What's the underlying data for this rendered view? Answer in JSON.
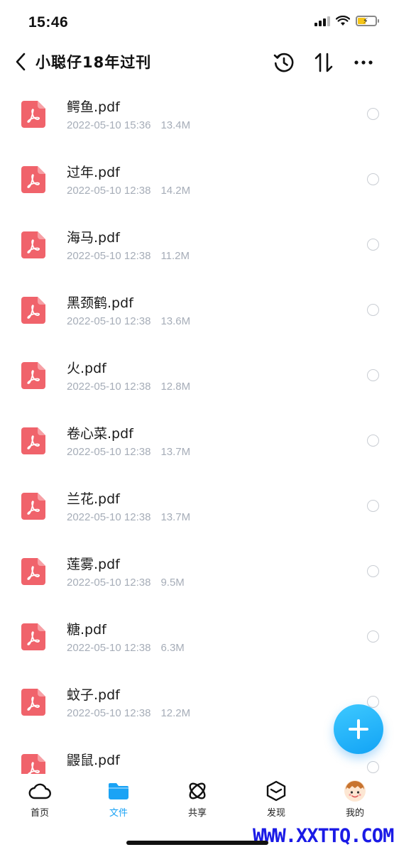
{
  "status_bar": {
    "time": "15:46"
  },
  "header": {
    "title": "小聪仔18年过刊"
  },
  "files": [
    {
      "name": "鳄鱼.pdf",
      "date": "2022-05-10 15:36",
      "size": "13.4M"
    },
    {
      "name": "过年.pdf",
      "date": "2022-05-10 12:38",
      "size": "14.2M"
    },
    {
      "name": "海马.pdf",
      "date": "2022-05-10 12:38",
      "size": "11.2M"
    },
    {
      "name": "黑颈鹤.pdf",
      "date": "2022-05-10 12:38",
      "size": "13.6M"
    },
    {
      "name": "火.pdf",
      "date": "2022-05-10 12:38",
      "size": "12.8M"
    },
    {
      "name": "卷心菜.pdf",
      "date": "2022-05-10 12:38",
      "size": "13.7M"
    },
    {
      "name": "兰花.pdf",
      "date": "2022-05-10 12:38",
      "size": "13.7M"
    },
    {
      "name": "莲雾.pdf",
      "date": "2022-05-10 12:38",
      "size": "9.5M"
    },
    {
      "name": "糖.pdf",
      "date": "2022-05-10 12:38",
      "size": "6.3M"
    },
    {
      "name": "蚊子.pdf",
      "date": "2022-05-10 12:38",
      "size": "12.2M"
    },
    {
      "name": "鼹鼠.pdf",
      "date": "",
      "size": ""
    }
  ],
  "bottom_nav": [
    {
      "label": "首页",
      "icon": "cloud-icon",
      "active": false
    },
    {
      "label": "文件",
      "icon": "folder-icon",
      "active": true
    },
    {
      "label": "共享",
      "icon": "atom-icon",
      "active": false
    },
    {
      "label": "发现",
      "icon": "box-icon",
      "active": false
    },
    {
      "label": "我的",
      "icon": "avatar-icon",
      "active": false
    }
  ],
  "watermark": "WWW.XXTTQ.COM",
  "colors": {
    "accent": "#1aa3f5",
    "pdf_icon": "#f0636b",
    "meta_text": "#a6adb8"
  }
}
